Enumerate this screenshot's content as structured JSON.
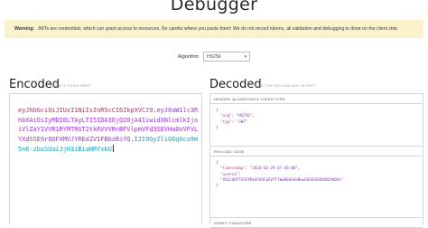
{
  "page": {
    "title": "Debugger"
  },
  "warning": {
    "label": "Warning:",
    "text": "JWTs are credentials, which can grant access to resources. Be careful where you paste them! We do not record tokens, all validation and debugging is done on the client side."
  },
  "algorithm": {
    "label": "Algorithm",
    "value": "HS256"
  },
  "encoded": {
    "title": "Encoded",
    "subtitle": "PASTE A TOKEN HERE",
    "header_part": "eyJhbGciOiJIUzI1NiIsInR5cCI6IkpXVCJ9",
    "payload_part": "eyJ0aW1lc3RhbXAiOiIyMDI0LTAyLTI5IDA3OjQ2OjA4IiwidXNlcmlkIjoiVlZaY1VVR1RYMTRGT2tkRVVVRnBFVlpmVFd3SEVHa0xVFVLYXdSSE9rQUFXMVJYREdZV1FBbzBifQ",
    "signature_part": "IJI9GyZliGOqXca9m5n6-zbsSUaiJjH3iBiaNRYxkU"
  },
  "decoded": {
    "title": "Decoded",
    "subtitle": "EDIT THE PAYLOAD AND SECRET",
    "header_label": "HEADER: ALGORITHM & TOKEN TYPE",
    "header_json": {
      "open": "{",
      "alg_key": "\"alg\"",
      "alg_val": "\"HS256\"",
      "typ_key": "\"typ\"",
      "typ_val": "\"JWT\"",
      "close": "}"
    },
    "payload_label": "PAYLOAD: DATA",
    "payload_json": {
      "open": "{",
      "ts_key": "\"timestamp\"",
      "ts_val": "\"2024-02-29 07:46:08\"",
      "uid_key": "\"userid\"",
      "uid_val": "\"VVZcUUFTX1F4RkdFUUFpEVfTlWwREKkGkNkwEUhEXAXRXDDYWQAo\"",
      "close": "}"
    },
    "signature_label": "VERIFY SIGNATURE"
  },
  "colors": {
    "header_part": "#e0245e",
    "payload_part": "#a72cff",
    "signature_part": "#00a8d8",
    "warning_bg": "#fbf2cc"
  }
}
